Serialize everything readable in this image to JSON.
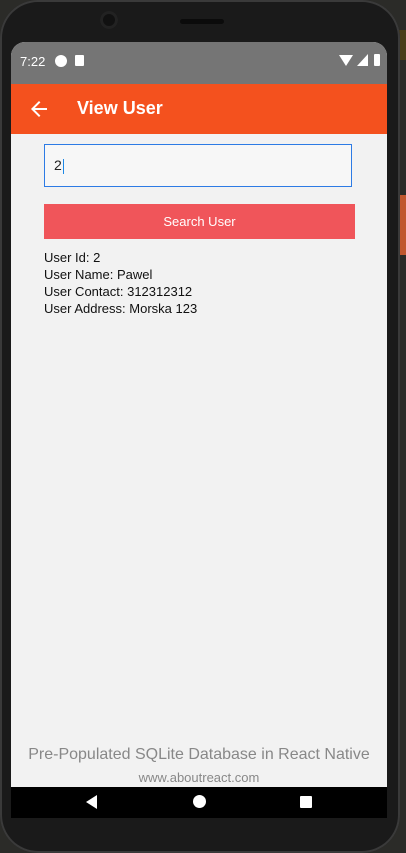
{
  "status_bar": {
    "time": "7:22",
    "icons": [
      "app-notification-icon",
      "clipboard-icon",
      "wifi-icon",
      "signal-icon",
      "battery-icon"
    ]
  },
  "toolbar": {
    "title": "View User",
    "back_icon": "arrow-left-icon",
    "color": "#f4511e"
  },
  "search": {
    "input_value": "2",
    "button_label": "Search User",
    "button_color": "#f0555a"
  },
  "user": {
    "id_line": "User Id: 2",
    "name_line": "User Name: Pawel",
    "contact_line": "User Contact: 312312312",
    "address_line": "User Address: Morska 123"
  },
  "footer": {
    "title": "Pre-Populated SQLite Database in React Native",
    "url": "www.aboutreact.com"
  },
  "nav_bar": {
    "icons": [
      "nav-back-icon",
      "nav-home-icon",
      "nav-recent-apps-icon"
    ]
  }
}
